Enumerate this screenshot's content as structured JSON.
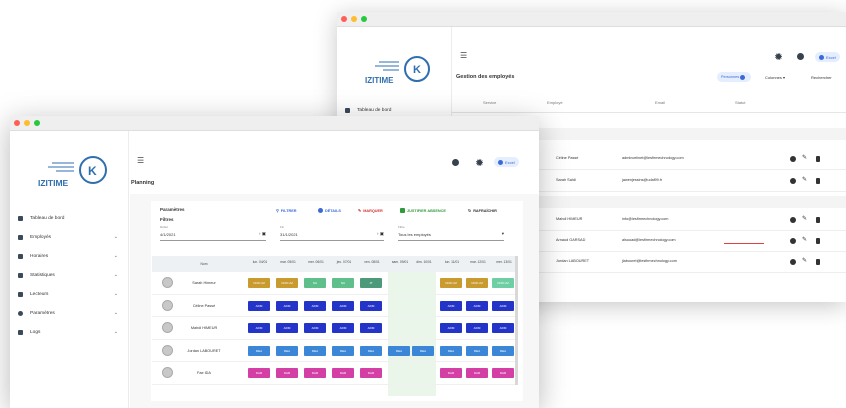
{
  "back_window": {
    "logo": "IZITIME",
    "nav": [
      "Tableau de bord"
    ],
    "header_button": "Excel",
    "page_title": "Gestion des employés",
    "toolbar": {
      "primary": "Personnes",
      "columns": "Colonnes",
      "search": "Rechercher"
    },
    "table_headers": [
      "Service",
      "Employé",
      "Email",
      "Statut"
    ],
    "rows": [
      {
        "name": "Céline Passé",
        "email": "admincelinet@lesfirmechnology.com"
      },
      {
        "name": "Sarah Saïdi",
        "email": "jawenjessins@udal99.fr"
      },
      {
        "name": "Mahdi HIMEUR",
        "email": "info@lesfirmechnology.com"
      },
      {
        "name": "Arnaud GARSAD",
        "email": "alsouad@lesfirmechnology.com"
      },
      {
        "name": "Jordan LABOURET",
        "email": "jlabouret@lesfirmechnology.com"
      }
    ]
  },
  "front_window": {
    "logo": "IZITIME",
    "nav": [
      {
        "label": "Tableau de bord",
        "chevron": false
      },
      {
        "label": "Employés",
        "chevron": true
      },
      {
        "label": "Horaires",
        "chevron": true
      },
      {
        "label": "Statistiques",
        "chevron": true
      },
      {
        "label": "Lecteurs",
        "chevron": true
      },
      {
        "label": "Paramètres",
        "chevron": true
      },
      {
        "label": "Logs",
        "chevron": true
      }
    ],
    "header_button": "Excel",
    "page_title": "Planning",
    "params_label": "Paramètres",
    "filters_label": "Filtres",
    "toolbar": {
      "filter": "FILTRER",
      "details": "DÉTAILS",
      "mark": "MARQUER",
      "justify": "JUSTIFIER ABSENCE",
      "refresh": "RAFRAÎCHIR"
    },
    "fields": [
      {
        "label": "Début",
        "value": "4/1/2021"
      },
      {
        "label": "Fin",
        "value": "31/1/2021"
      },
      {
        "label": "Filtre",
        "value": "Tous les employés"
      }
    ],
    "col_header": "Nom",
    "days": [
      "lun. 04/01",
      "mar. 05/01",
      "mer. 06/01",
      "jeu. 07/01",
      "ven. 08/01",
      "sam. 09/01",
      "dim. 10/01",
      "lun. 11/01",
      "mar. 12/01",
      "mer. 13/01"
    ],
    "weekend_days": [
      5,
      6
    ],
    "employees": [
      {
        "name": "Sarah Himeur",
        "code": "CDR LM",
        "chips": [
          "CDR LM",
          "CDR LM",
          "NU",
          "NU",
          "JT",
          "",
          "",
          "CDR LM",
          "CDR LM",
          "CDR LM"
        ],
        "colors": [
          "#c99a2e",
          "#c99a2e",
          "#5fbf8b",
          "#5fbf8b",
          "#4d9a7b",
          "",
          "",
          "#c99a2e",
          "#c99a2e",
          "#6fcfa4"
        ]
      },
      {
        "name": "Céline Passé",
        "chips": [
          "ADM",
          "ADM",
          "ADM",
          "ADM",
          "ADM",
          "",
          "",
          "ADM",
          "ADM",
          "ADM"
        ],
        "color": "#2433c8"
      },
      {
        "name": "Mahdi HIMEUR",
        "chips": [
          "ADM",
          "ADM",
          "ADM",
          "ADM",
          "ADM",
          "",
          "",
          "ADM",
          "ADM",
          "ADM"
        ],
        "color": "#2433c8"
      },
      {
        "name": "Jordan LABOURET",
        "chips": [
          "REA",
          "REA",
          "REA",
          "REA",
          "REA",
          "REA",
          "REA",
          "REA",
          "REA",
          "REA"
        ],
        "color": "#3b86d6"
      },
      {
        "name": "Fae IDA",
        "chips": [
          "DAR",
          "DAR",
          "DAR",
          "DAR",
          "DAR",
          "",
          "",
          "DAR",
          "DAR",
          "DAR"
        ],
        "color": "#d43fa5"
      }
    ]
  },
  "colors": {
    "accent": "#2f6fb0",
    "weekend_shade": "#eaf6ea"
  }
}
